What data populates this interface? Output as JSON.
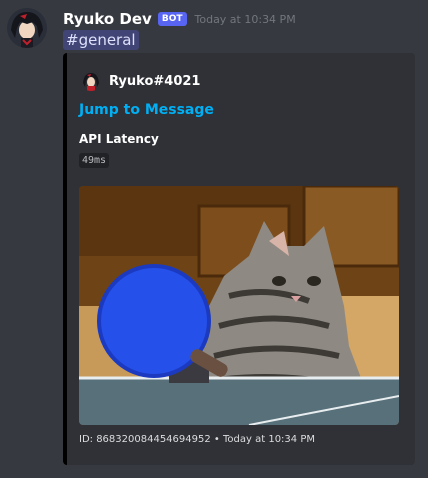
{
  "message": {
    "username": "Ryuko Dev",
    "bot_tag": "BOT",
    "timestamp": "Today at 10:34 PM",
    "channel_mention": "#general"
  },
  "embed": {
    "accent_color": "#000000",
    "author": "Ryuko#4021",
    "title": "Jump to Message",
    "field_name": "API Latency",
    "field_value": "49ms",
    "image_icon": "cat-ping-pong-gif",
    "footer": {
      "id_label": "ID: 868320084454694952",
      "separator": "•",
      "time": "Today at 10:34 PM"
    }
  },
  "colors": {
    "background": "#36393f",
    "embed_background": "#2f3136",
    "bot_tag": "#5865f2",
    "link": "#00aff4"
  }
}
